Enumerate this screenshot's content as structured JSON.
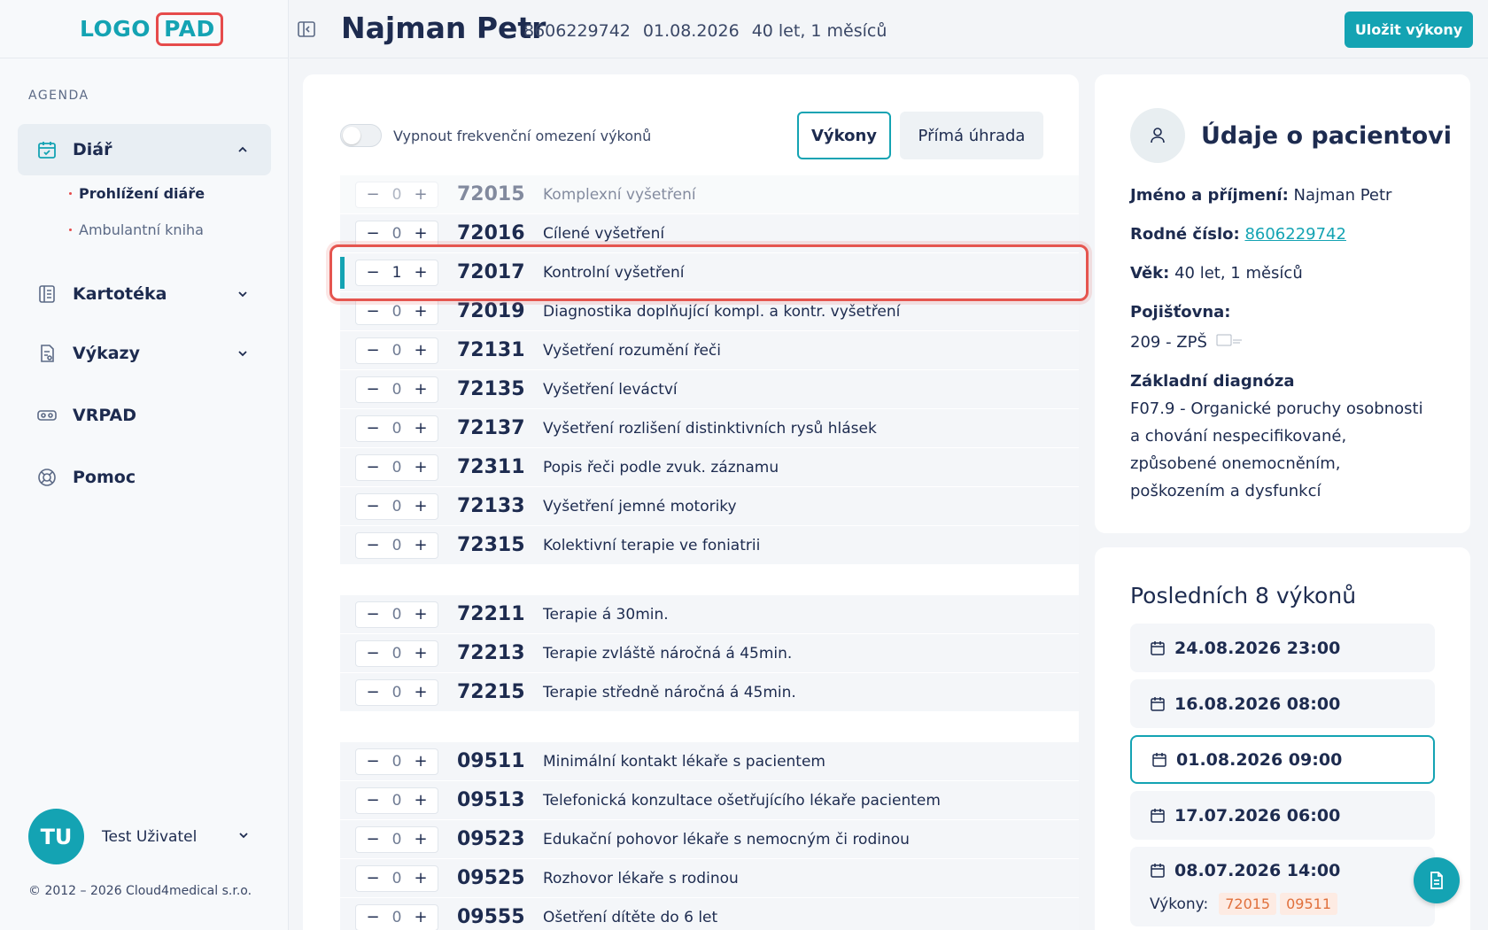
{
  "logo": {
    "part1": "LOGO",
    "part2": "PAD"
  },
  "sidebar": {
    "section_label": "AGENDA",
    "items": [
      {
        "label": "Diář",
        "icon": "calendar-check-icon"
      },
      {
        "label": "Kartotéka",
        "icon": "book-icon"
      },
      {
        "label": "Výkazy",
        "icon": "report-icon"
      },
      {
        "label": "VRPAD",
        "icon": "vr-headset-icon"
      },
      {
        "label": "Pomoc",
        "icon": "lifebuoy-icon"
      }
    ],
    "diar_subitems": [
      "Prohlížení diáře",
      "Ambulantní kniha"
    ],
    "user": {
      "initials": "TU",
      "name": "Test Uživatel"
    },
    "copyright": "© 2012 – 2026 Cloud4medical s.r.o."
  },
  "header": {
    "patient_name": "Najman Petr",
    "birth_number": "8606229742",
    "date": "01.08.2026",
    "age": "40 let, 1 měsíců",
    "save_button": "Uložit výkony"
  },
  "main": {
    "toggle_label": "Vypnout frekvenční omezení výkonů",
    "tabs": [
      "Výkony",
      "Přímá úhrada"
    ],
    "rows": [
      {
        "qty": "0",
        "code": "72015",
        "desc": "Komplexní vyšetření"
      },
      {
        "qty": "0",
        "code": "72016",
        "desc": "Cílené vyšetření"
      },
      {
        "qty": "1",
        "code": "72017",
        "desc": "Kontrolní vyšetření"
      },
      {
        "qty": "0",
        "code": "72019",
        "desc": "Diagnostika doplňující kompl. a kontr. vyšetření"
      },
      {
        "qty": "0",
        "code": "72131",
        "desc": "Vyšetření rozumění řeči"
      },
      {
        "qty": "0",
        "code": "72135",
        "desc": "Vyšetření leváctví"
      },
      {
        "qty": "0",
        "code": "72137",
        "desc": "Vyšetření rozlišení distinktivních rysů hlásek"
      },
      {
        "qty": "0",
        "code": "72311",
        "desc": "Popis řeči podle zvuk. záznamu"
      },
      {
        "qty": "0",
        "code": "72133",
        "desc": "Vyšetření jemné motoriky"
      },
      {
        "qty": "0",
        "code": "72315",
        "desc": "Kolektivní terapie ve foniatrii"
      },
      {
        "qty": "0",
        "code": "72211",
        "desc": "Terapie á 30min."
      },
      {
        "qty": "0",
        "code": "72213",
        "desc": "Terapie zvláště náročná á 45min."
      },
      {
        "qty": "0",
        "code": "72215",
        "desc": "Terapie středně náročná á 45min."
      },
      {
        "qty": "0",
        "code": "09511",
        "desc": "Minimální kontakt lékaře s pacientem"
      },
      {
        "qty": "0",
        "code": "09513",
        "desc": "Telefonická konzultace ošetřujícího lékaře pacientem"
      },
      {
        "qty": "0",
        "code": "09523",
        "desc": "Edukační pohovor lékaře s nemocným či rodinou"
      },
      {
        "qty": "0",
        "code": "09525",
        "desc": "Rozhovor lékaře s rodinou"
      },
      {
        "qty": "0",
        "code": "09555",
        "desc": "Ošetření dítěte do 6 let"
      }
    ]
  },
  "patient_info": {
    "title": "Údaje o pacientovi",
    "name_label": "Jméno a příjmení:",
    "name_value": "Najman Petr",
    "rc_label": "Rodné číslo:",
    "rc_value": "8606229742",
    "age_label": "Věk:",
    "age_value": "40 let, 1 měsíců",
    "insurance_label": "Pojišťovna:",
    "insurance_value": "209 - ZPŠ",
    "diag_label": "Základní diagnóza",
    "diag_line1": "F07.9 - Organické poruchy osobnosti",
    "diag_line2": "a chování nespecifikované,",
    "diag_line3": "způsobené onemocněním,",
    "diag_line4": "poškozením a dysfunkcí"
  },
  "recent": {
    "title": "Posledních 8 výkonů",
    "items": [
      "24.08.2026 23:00",
      "16.08.2026 08:00",
      "01.08.2026 09:00",
      "17.07.2026 06:00",
      "08.07.2026 14:00"
    ],
    "vykony_label": "Výkony:",
    "chips": [
      "72015",
      "09511"
    ]
  },
  "colors": {
    "accent": "#14a3b3",
    "highlight": "#e5554f"
  }
}
